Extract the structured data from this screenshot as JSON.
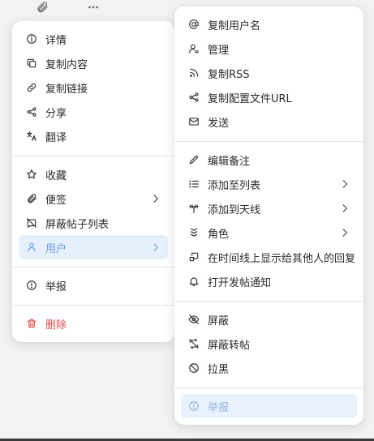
{
  "colors": {
    "background": "#f2f2f4",
    "menu_bg": "#ffffff",
    "highlight_bg": "#e6f0fd",
    "highlight_text": "#6d9ee6",
    "danger": "#e04848",
    "disabled_text": "#94b4de"
  },
  "toolbar": {
    "icons": [
      "paperclip-icon",
      "more-icon"
    ]
  },
  "left_menu": {
    "items": [
      {
        "label": "详情",
        "icon": "info-icon"
      },
      {
        "label": "复制内容",
        "icon": "copy-icon"
      },
      {
        "label": "复制链接",
        "icon": "link-icon"
      },
      {
        "label": "分享",
        "icon": "share-icon"
      },
      {
        "label": "翻译",
        "icon": "translate-icon"
      },
      {
        "label": "收藏",
        "icon": "star-icon"
      },
      {
        "label": "便签",
        "icon": "paperclip-icon"
      },
      {
        "label": "屏蔽帖子列表",
        "icon": "block-list-icon"
      },
      {
        "label": "用户",
        "icon": "user-icon"
      },
      {
        "label": "举报",
        "icon": "report-icon"
      },
      {
        "label": "删除",
        "icon": "trash-icon"
      }
    ]
  },
  "right_menu": {
    "items": [
      {
        "label": "复制用户名",
        "icon": "at-icon"
      },
      {
        "label": "管理",
        "icon": "manage-user-icon"
      },
      {
        "label": "复制RSS",
        "icon": "rss-icon"
      },
      {
        "label": "复制配置文件URL",
        "icon": "share-icon"
      },
      {
        "label": "发送",
        "icon": "mail-icon"
      },
      {
        "label": "编辑备注",
        "icon": "pencil-icon"
      },
      {
        "label": "添加至列表",
        "icon": "list-icon"
      },
      {
        "label": "添加到天线",
        "icon": "antenna-icon"
      },
      {
        "label": "角色",
        "icon": "badges-icon"
      },
      {
        "label": "在时间线上显示给其他人的回复",
        "icon": "reply-visibility-icon"
      },
      {
        "label": "打开发帖通知",
        "icon": "bell-icon"
      },
      {
        "label": "屏蔽",
        "icon": "eye-off-icon"
      },
      {
        "label": "屏蔽转帖",
        "icon": "repost-off-icon"
      },
      {
        "label": "拉黑",
        "icon": "ban-icon"
      },
      {
        "label": "举报",
        "icon": "report-icon"
      }
    ]
  }
}
